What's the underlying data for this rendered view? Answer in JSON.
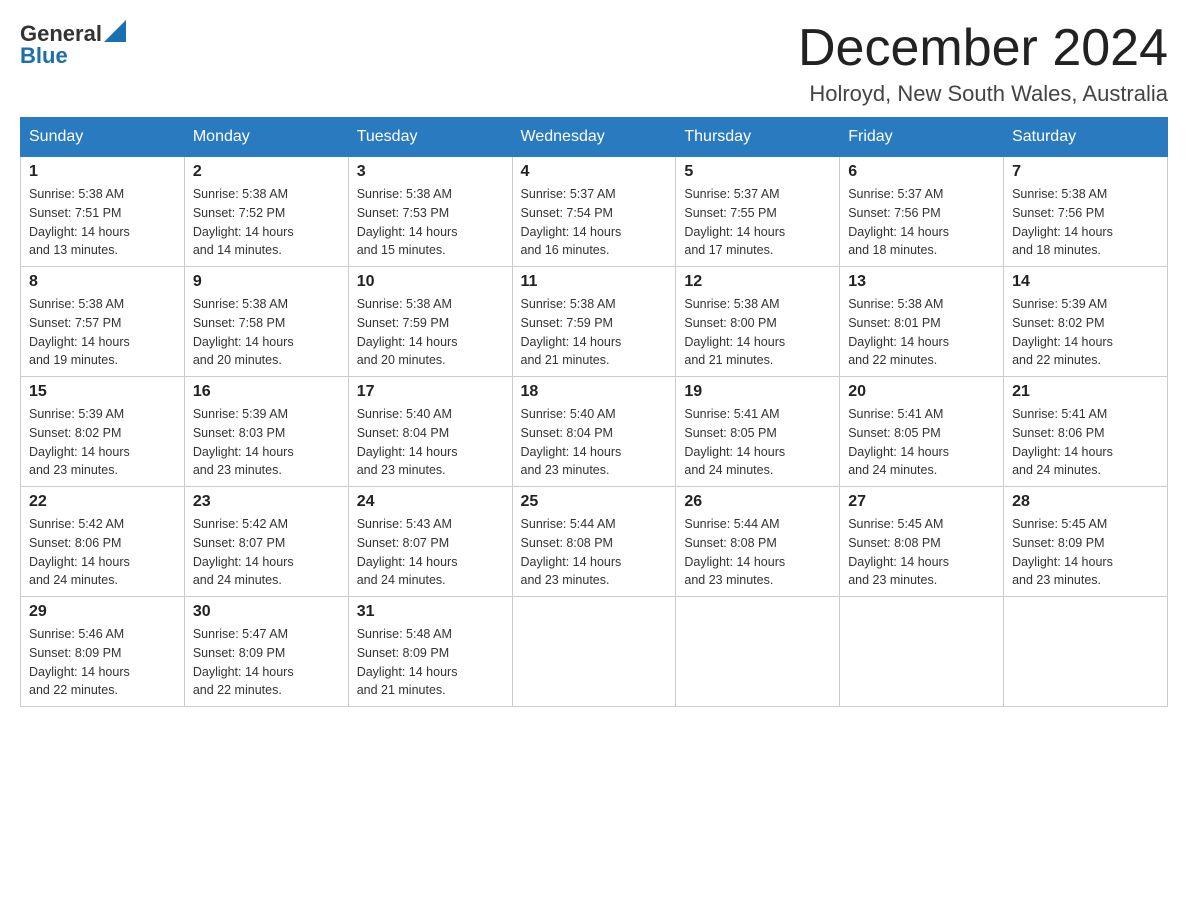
{
  "header": {
    "logo_general": "General",
    "logo_blue": "Blue",
    "month_title": "December 2024",
    "location": "Holroyd, New South Wales, Australia"
  },
  "weekdays": [
    "Sunday",
    "Monday",
    "Tuesday",
    "Wednesday",
    "Thursday",
    "Friday",
    "Saturday"
  ],
  "weeks": [
    [
      {
        "day": "1",
        "sunrise": "5:38 AM",
        "sunset": "7:51 PM",
        "daylight": "14 hours and 13 minutes."
      },
      {
        "day": "2",
        "sunrise": "5:38 AM",
        "sunset": "7:52 PM",
        "daylight": "14 hours and 14 minutes."
      },
      {
        "day": "3",
        "sunrise": "5:38 AM",
        "sunset": "7:53 PM",
        "daylight": "14 hours and 15 minutes."
      },
      {
        "day": "4",
        "sunrise": "5:37 AM",
        "sunset": "7:54 PM",
        "daylight": "14 hours and 16 minutes."
      },
      {
        "day": "5",
        "sunrise": "5:37 AM",
        "sunset": "7:55 PM",
        "daylight": "14 hours and 17 minutes."
      },
      {
        "day": "6",
        "sunrise": "5:37 AM",
        "sunset": "7:56 PM",
        "daylight": "14 hours and 18 minutes."
      },
      {
        "day": "7",
        "sunrise": "5:38 AM",
        "sunset": "7:56 PM",
        "daylight": "14 hours and 18 minutes."
      }
    ],
    [
      {
        "day": "8",
        "sunrise": "5:38 AM",
        "sunset": "7:57 PM",
        "daylight": "14 hours and 19 minutes."
      },
      {
        "day": "9",
        "sunrise": "5:38 AM",
        "sunset": "7:58 PM",
        "daylight": "14 hours and 20 minutes."
      },
      {
        "day": "10",
        "sunrise": "5:38 AM",
        "sunset": "7:59 PM",
        "daylight": "14 hours and 20 minutes."
      },
      {
        "day": "11",
        "sunrise": "5:38 AM",
        "sunset": "7:59 PM",
        "daylight": "14 hours and 21 minutes."
      },
      {
        "day": "12",
        "sunrise": "5:38 AM",
        "sunset": "8:00 PM",
        "daylight": "14 hours and 21 minutes."
      },
      {
        "day": "13",
        "sunrise": "5:38 AM",
        "sunset": "8:01 PM",
        "daylight": "14 hours and 22 minutes."
      },
      {
        "day": "14",
        "sunrise": "5:39 AM",
        "sunset": "8:02 PM",
        "daylight": "14 hours and 22 minutes."
      }
    ],
    [
      {
        "day": "15",
        "sunrise": "5:39 AM",
        "sunset": "8:02 PM",
        "daylight": "14 hours and 23 minutes."
      },
      {
        "day": "16",
        "sunrise": "5:39 AM",
        "sunset": "8:03 PM",
        "daylight": "14 hours and 23 minutes."
      },
      {
        "day": "17",
        "sunrise": "5:40 AM",
        "sunset": "8:04 PM",
        "daylight": "14 hours and 23 minutes."
      },
      {
        "day": "18",
        "sunrise": "5:40 AM",
        "sunset": "8:04 PM",
        "daylight": "14 hours and 23 minutes."
      },
      {
        "day": "19",
        "sunrise": "5:41 AM",
        "sunset": "8:05 PM",
        "daylight": "14 hours and 24 minutes."
      },
      {
        "day": "20",
        "sunrise": "5:41 AM",
        "sunset": "8:05 PM",
        "daylight": "14 hours and 24 minutes."
      },
      {
        "day": "21",
        "sunrise": "5:41 AM",
        "sunset": "8:06 PM",
        "daylight": "14 hours and 24 minutes."
      }
    ],
    [
      {
        "day": "22",
        "sunrise": "5:42 AM",
        "sunset": "8:06 PM",
        "daylight": "14 hours and 24 minutes."
      },
      {
        "day": "23",
        "sunrise": "5:42 AM",
        "sunset": "8:07 PM",
        "daylight": "14 hours and 24 minutes."
      },
      {
        "day": "24",
        "sunrise": "5:43 AM",
        "sunset": "8:07 PM",
        "daylight": "14 hours and 24 minutes."
      },
      {
        "day": "25",
        "sunrise": "5:44 AM",
        "sunset": "8:08 PM",
        "daylight": "14 hours and 23 minutes."
      },
      {
        "day": "26",
        "sunrise": "5:44 AM",
        "sunset": "8:08 PM",
        "daylight": "14 hours and 23 minutes."
      },
      {
        "day": "27",
        "sunrise": "5:45 AM",
        "sunset": "8:08 PM",
        "daylight": "14 hours and 23 minutes."
      },
      {
        "day": "28",
        "sunrise": "5:45 AM",
        "sunset": "8:09 PM",
        "daylight": "14 hours and 23 minutes."
      }
    ],
    [
      {
        "day": "29",
        "sunrise": "5:46 AM",
        "sunset": "8:09 PM",
        "daylight": "14 hours and 22 minutes."
      },
      {
        "day": "30",
        "sunrise": "5:47 AM",
        "sunset": "8:09 PM",
        "daylight": "14 hours and 22 minutes."
      },
      {
        "day": "31",
        "sunrise": "5:48 AM",
        "sunset": "8:09 PM",
        "daylight": "14 hours and 21 minutes."
      },
      null,
      null,
      null,
      null
    ]
  ],
  "labels": {
    "sunrise": "Sunrise:",
    "sunset": "Sunset:",
    "daylight": "Daylight:"
  }
}
